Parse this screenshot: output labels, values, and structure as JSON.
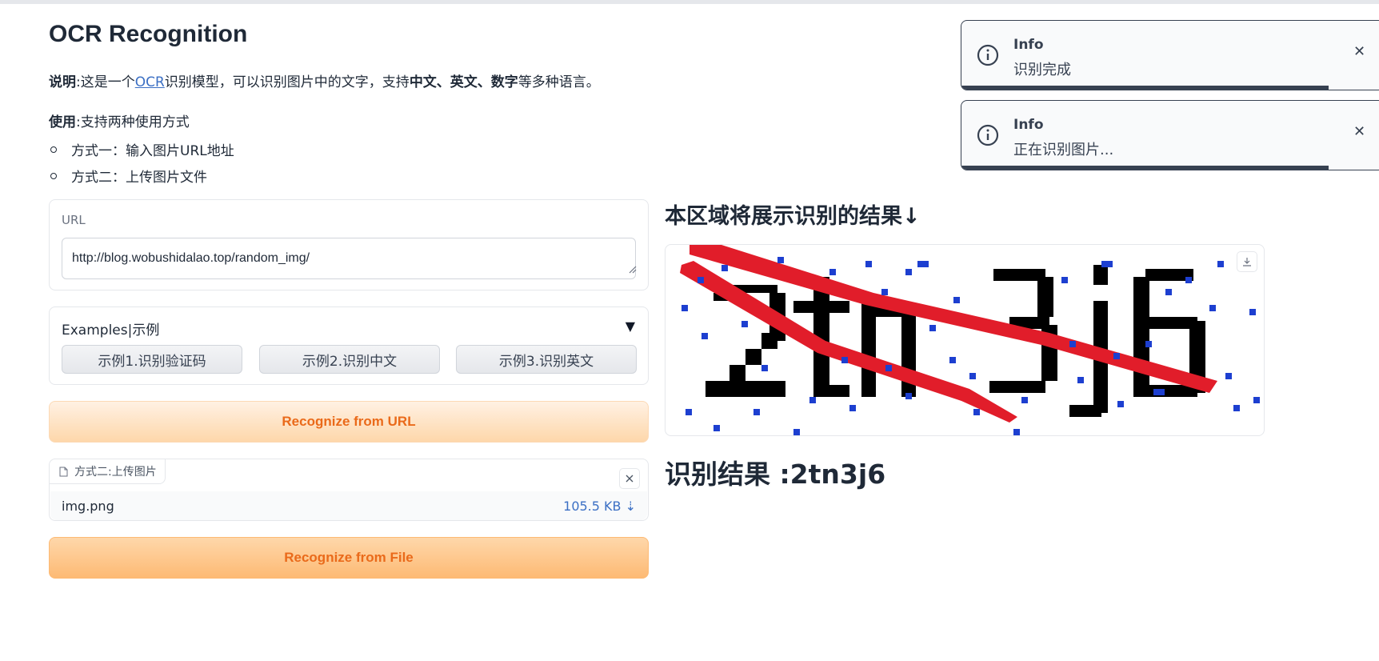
{
  "app": {
    "title": "OCR Recognition"
  },
  "intro": {
    "desc_label": "说明",
    "desc_pre": ":这是一个",
    "desc_link": "OCR",
    "desc_mid": "识别模型，可以识别图片中的文字，支持",
    "desc_langs": "中文、英文、数字",
    "desc_post": "等多种语言。",
    "usage_label": "使用",
    "usage_text": ":支持两种使用方式",
    "methods": [
      "方式一：输入图片URL地址",
      "方式二：上传图片文件"
    ]
  },
  "url_input": {
    "label": "URL",
    "value": "http://blog.wobushidalao.top/random_img/"
  },
  "examples": {
    "label": "Examples|示例",
    "toggle": "▼",
    "buttons": [
      "示例1.识别验证码",
      "示例2.识别中文",
      "示例3.识别英文"
    ]
  },
  "buttons": {
    "recognize_url": "Recognize from URL",
    "recognize_file": "Recognize from File"
  },
  "file_upload": {
    "tab_label": "方式二:上传图片",
    "file_name": "img.png",
    "file_size": "105.5 KB ⇣"
  },
  "result": {
    "heading": "本区域将展示识别的结果↓",
    "text": "识别结果 :2tn3j6",
    "captcha_text": "2tn3j6"
  },
  "toasts": [
    {
      "title": "Info",
      "message": "识别完成",
      "progress": 0.87
    },
    {
      "title": "Info",
      "message": "正在识别图片...",
      "progress": 0.87
    }
  ],
  "colors": {
    "accent_orange": "#ea6a1a",
    "link_blue": "#3b6fc4",
    "captcha_red": "#e11d2a",
    "captcha_blue": "#1d3fd0"
  }
}
